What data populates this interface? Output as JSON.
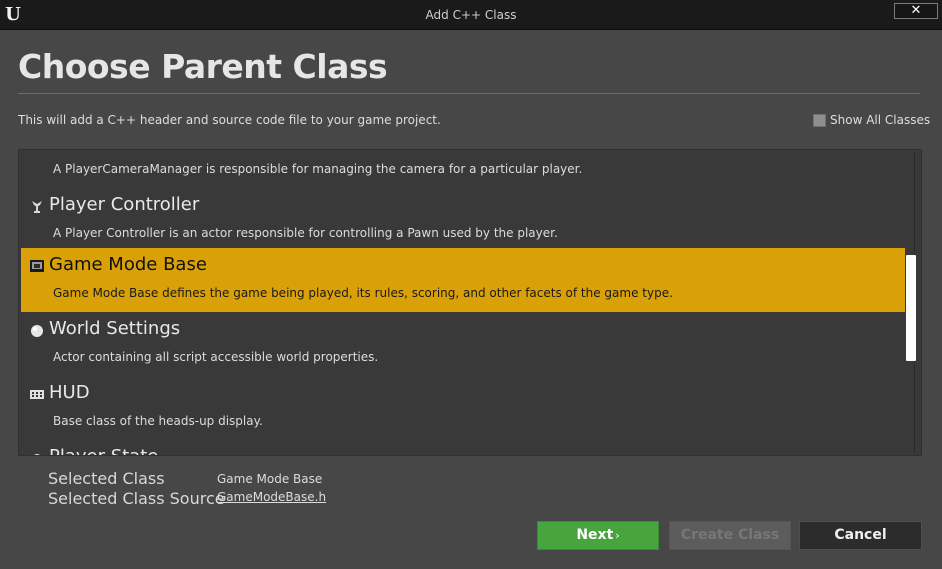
{
  "window": {
    "title": "Add C++ Class",
    "close_label": "✕",
    "logo_text": "U"
  },
  "header": {
    "title": "Choose Parent Class",
    "description": "This will add a C++ header and source code file to your game project.",
    "show_all_label": "Show All Classes",
    "show_all_checked": false
  },
  "class_list": {
    "items": [
      {
        "name": "",
        "description": "A PlayerCameraManager is responsible for managing the camera for a particular player.",
        "icon": "camera-icon",
        "selected": false
      },
      {
        "name": "Player Controller",
        "description": "A Player Controller is an actor responsible for controlling a Pawn used by the player.",
        "icon": "player-controller-icon",
        "selected": false
      },
      {
        "name": "Game Mode Base",
        "description": "Game Mode Base defines the game being played, its rules, scoring, and other facets of the game type.",
        "icon": "game-mode-icon",
        "selected": true
      },
      {
        "name": "World Settings",
        "description": "Actor containing all script accessible world properties.",
        "icon": "world-settings-icon",
        "selected": false
      },
      {
        "name": "HUD",
        "description": "Base class of the heads-up display.",
        "icon": "hud-icon",
        "selected": false
      },
      {
        "name": "Player State",
        "description": "",
        "icon": "player-state-icon",
        "selected": false
      }
    ]
  },
  "selection": {
    "class_label": "Selected Class",
    "class_value": "Game Mode Base",
    "source_label": "Selected Class Source",
    "source_value": "GameModeBase.h"
  },
  "buttons": {
    "next": "Next",
    "next_chevron": "›",
    "create": "Create Class",
    "cancel": "Cancel"
  },
  "colors": {
    "selected_row": "#d9a007",
    "next_button": "#48a43c",
    "background": "#474747",
    "list_background": "#393939"
  }
}
